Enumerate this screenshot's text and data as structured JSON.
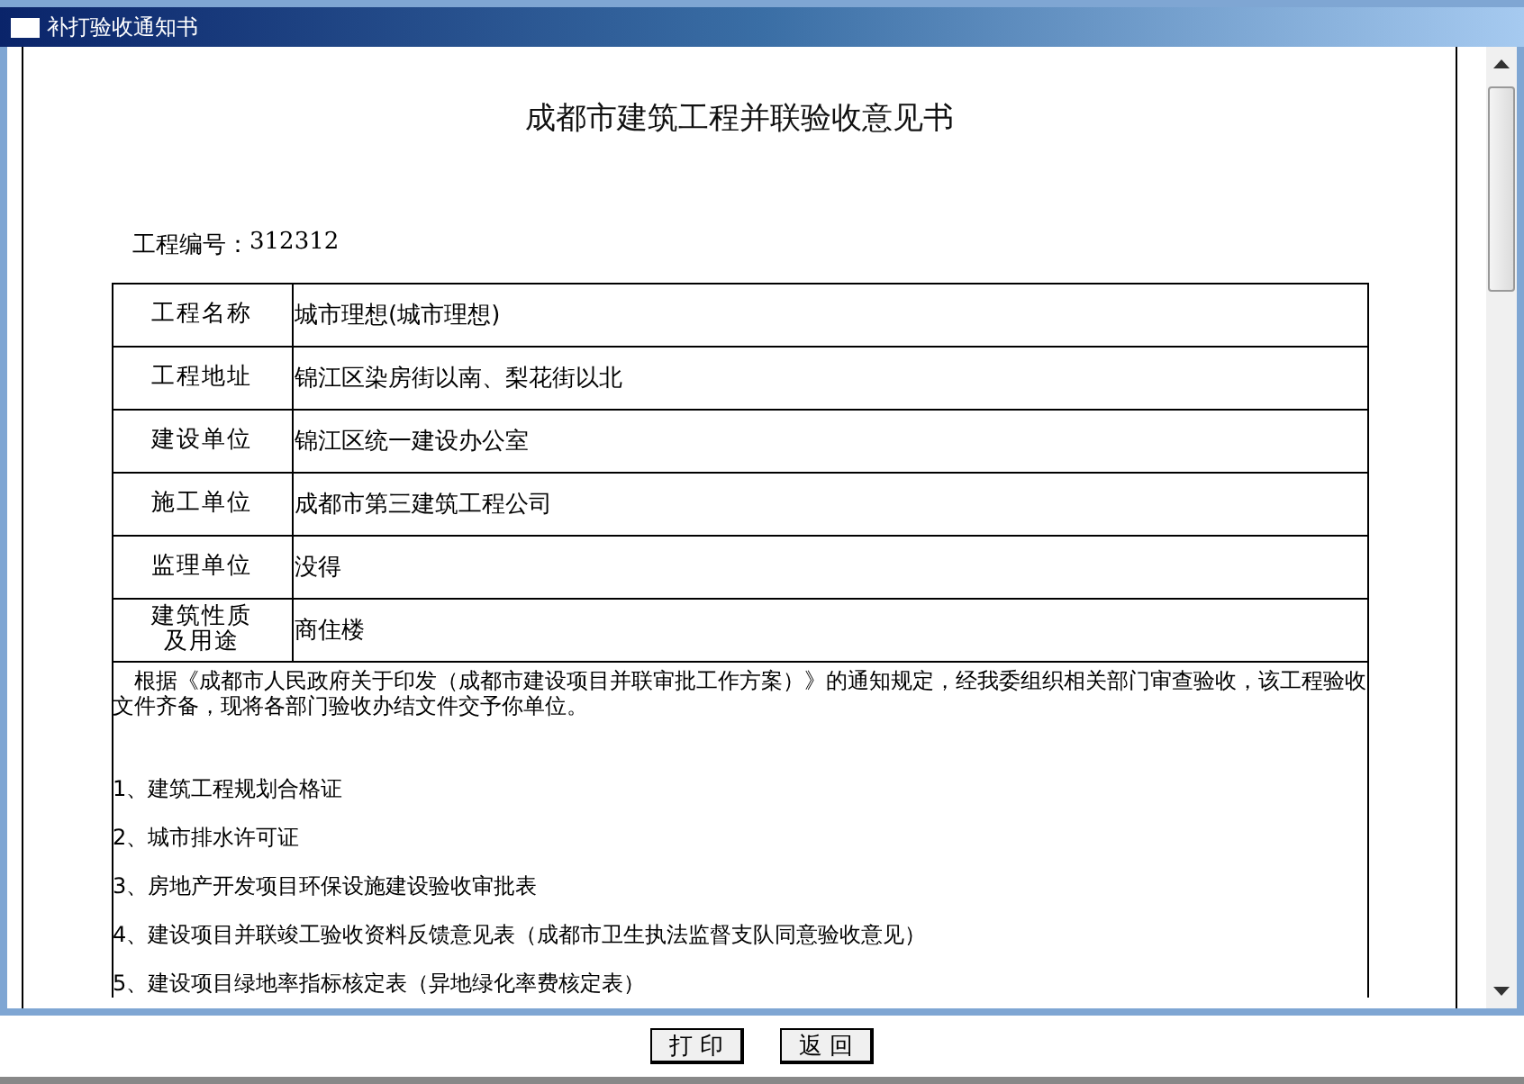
{
  "window": {
    "title": "补打验收通知书"
  },
  "document": {
    "heading": "成都市建筑工程并联验收意见书",
    "project_number_label": "工程编号：",
    "project_number": "312312",
    "rows": [
      {
        "label": "工程名称",
        "value": "城市理想(城市理想)"
      },
      {
        "label": "工程地址",
        "value": "锦江区染房街以南、梨花街以北"
      },
      {
        "label": "建设单位",
        "value": "锦江区统一建设办公室"
      },
      {
        "label": "施工单位",
        "value": "成都市第三建筑工程公司"
      },
      {
        "label": "监理单位",
        "value": "没得"
      },
      {
        "label": "建筑性质及用途",
        "value": "商住楼"
      }
    ],
    "paragraph": "　根据《成都市人民政府关于印发（成都市建设项目并联审批工作方案）》的通知规定，经我委组织相关部门审查验收，该工程验收文件齐备，现将各部门验收办结文件交予你单位。",
    "items": [
      "1、建筑工程规划合格证",
      "2、城市排水许可证",
      "3、房地产开发项目环保设施建设验收审批表",
      "4、建设项目并联竣工验收资料反馈意见表（成都市卫生执法监督支队同意验收意见）",
      "5、建设项目绿地率指标核定表（异地绿化率费核定表）"
    ]
  },
  "buttons": [
    "打 印",
    "返 回"
  ]
}
